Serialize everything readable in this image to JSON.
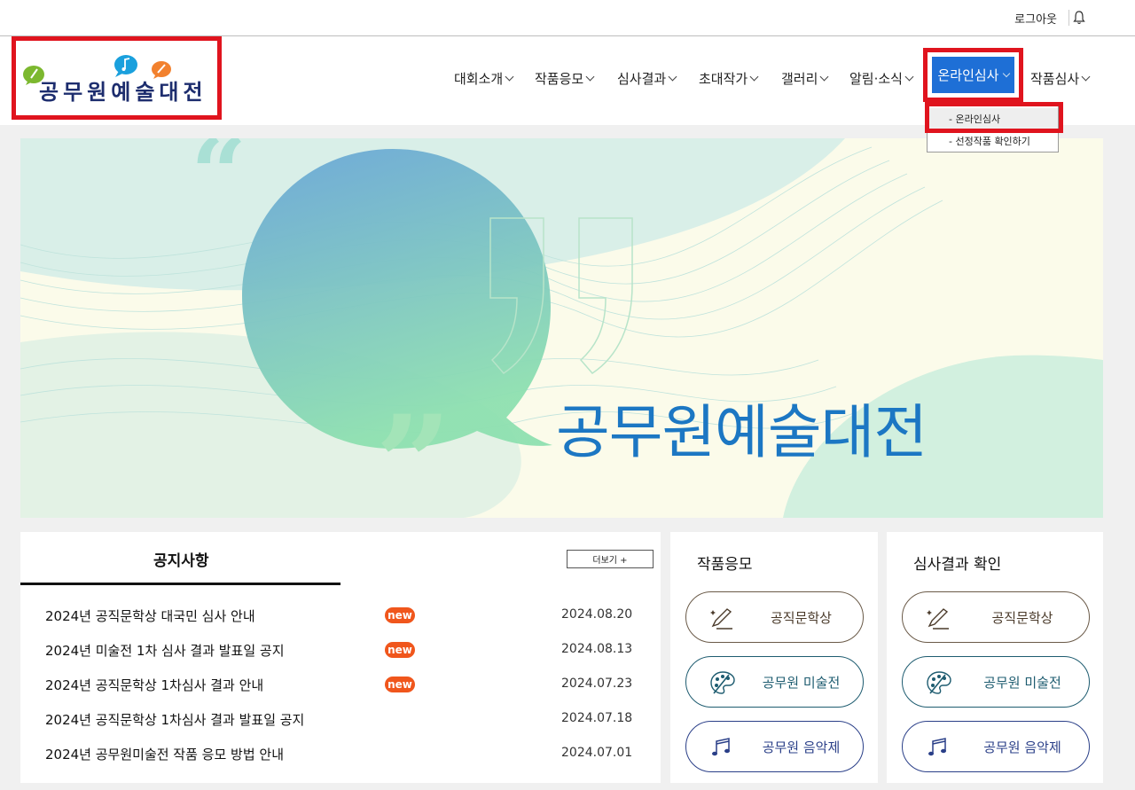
{
  "topbar": {
    "logout_label": "로그아웃"
  },
  "logo": {
    "text": "공무원예술대전"
  },
  "nav": {
    "items": [
      "대회소개",
      "작품응모",
      "심사결과",
      "초대작가",
      "갤러리",
      "알림·소식"
    ],
    "active": "온라인심사",
    "last": "작품심사"
  },
  "submenu": {
    "items": [
      "- 온라인심사",
      "- 선정작품 확인하기"
    ]
  },
  "hero": {
    "title": "공무원예술대전"
  },
  "notice": {
    "title": "공지사항",
    "more_label": "더보기 +",
    "new_label": "new",
    "rows": [
      {
        "title": "2024년 공직문학상 대국민 심사 안내",
        "date": "2024.08.20"
      },
      {
        "title": "2024년 미술전 1차 심사 결과 발표일 공지",
        "date": "2024.08.13"
      },
      {
        "title": "2024년 공직문학상 1차심사 결과 안내",
        "date": "2024.07.23"
      },
      {
        "title": "2024년 공직문학상 1차심사 결과 발표일 공지",
        "date": "2024.07.18"
      },
      {
        "title": "2024년 공무원미술전 작품 응모 방법 안내",
        "date": "2024.07.01"
      }
    ]
  },
  "apply": {
    "title": "작품응모",
    "buttons": [
      "공직문학상",
      "공무원 미술전",
      "공무원 음악제"
    ]
  },
  "result": {
    "title": "심사결과 확인",
    "buttons": [
      "공직문학상",
      "공무원 미술전",
      "공무원 음악제"
    ]
  },
  "colors": {
    "accent": "#1e6fd6",
    "highlight": "#e0141e",
    "new_badge": "#f0561c",
    "hero_title": "#1c77c3"
  }
}
